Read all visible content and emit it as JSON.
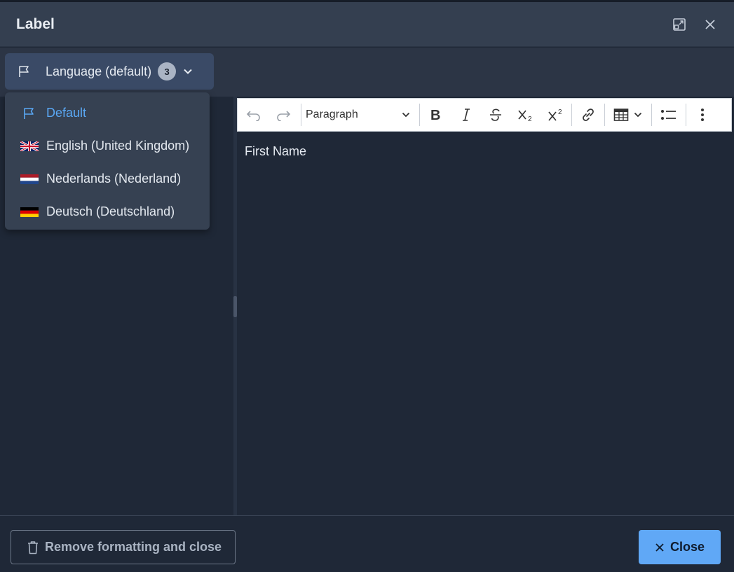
{
  "dialog": {
    "title": "Label",
    "expand_icon": "expand-icon",
    "close_icon": "close-icon"
  },
  "language_selector": {
    "label": "Language (default)",
    "count": "3",
    "icon": "flag-icon",
    "items": [
      {
        "label": "Default",
        "icon": "flag-outline-icon",
        "active": true
      },
      {
        "label": "English (United Kingdom)",
        "icon": "uk-flag-icon"
      },
      {
        "label": "Nederlands (Nederland)",
        "icon": "nl-flag-icon"
      },
      {
        "label": "Deutsch (Deutschland)",
        "icon": "de-flag-icon"
      }
    ]
  },
  "toolbar": {
    "block_format": "Paragraph",
    "tools": [
      "undo-icon",
      "redo-icon",
      "bold-icon",
      "italic-icon",
      "strikethrough-icon",
      "subscript-icon",
      "superscript-icon",
      "link-icon",
      "table-icon",
      "bulleted-list-icon",
      "more-icon"
    ]
  },
  "editor": {
    "content": "First Name"
  },
  "footer": {
    "remove_label": "Remove formatting and close",
    "close_label": "Close"
  },
  "colors": {
    "accent": "#60a8f6",
    "active_item": "#5aa8f5",
    "background": "#1f2837",
    "header": "#343f50"
  }
}
